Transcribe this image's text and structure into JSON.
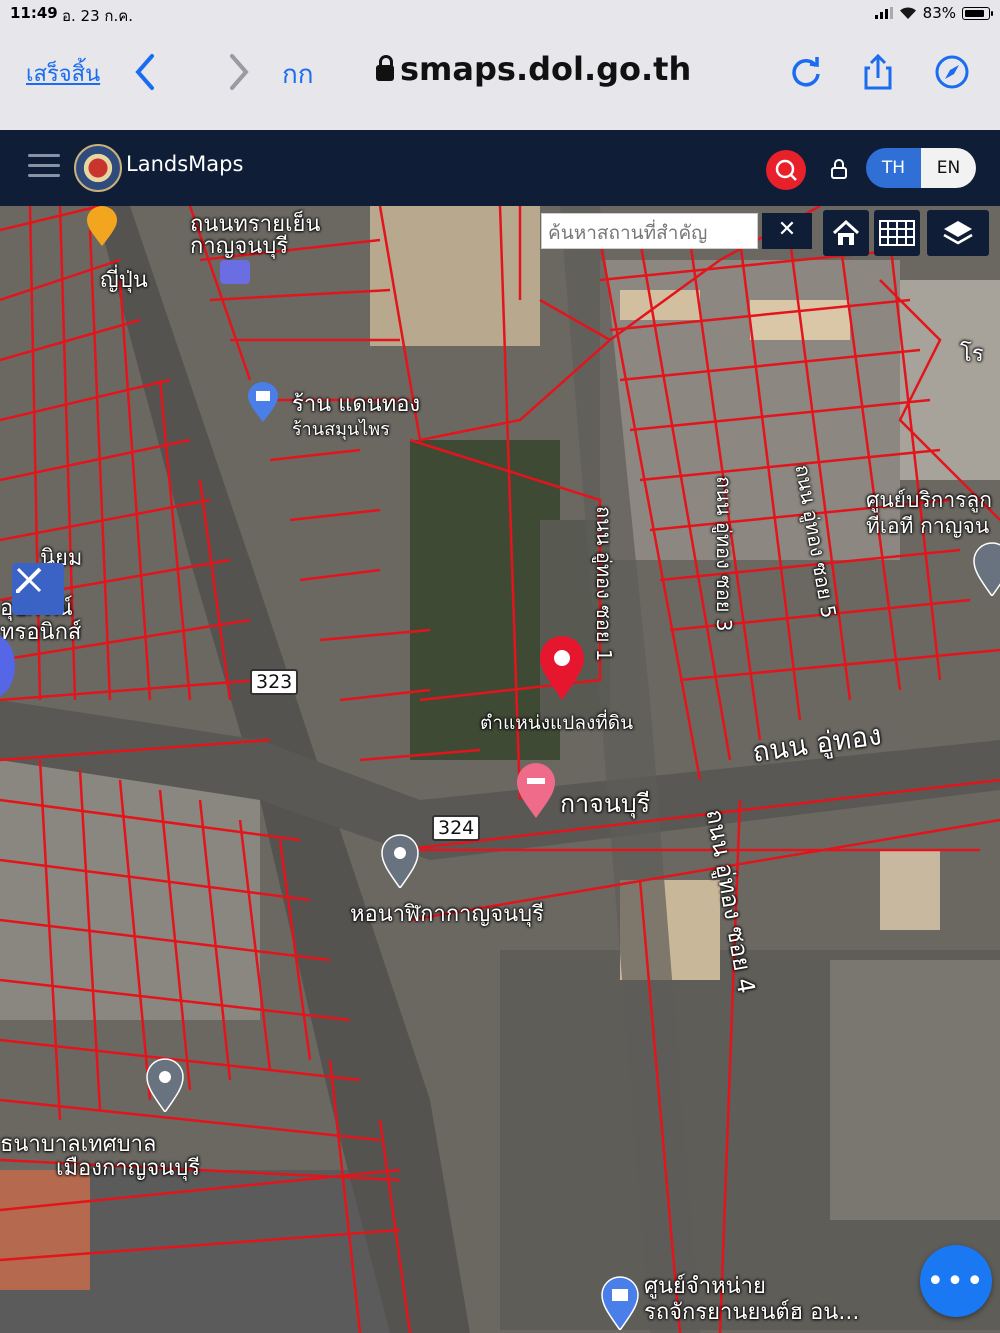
{
  "status_bar": {
    "time": "11:49",
    "date": "อ. 23 ก.ค.",
    "battery": "83%"
  },
  "browser": {
    "done_label": "เสร็จสิ้น",
    "text_size_label": "กก",
    "url": "smaps.dol.go.th",
    "icons": [
      "back-icon",
      "forward-icon",
      "lock-icon",
      "reload-icon",
      "share-icon",
      "compass-icon"
    ]
  },
  "app": {
    "brand": "LandsMaps",
    "lang_th": "TH",
    "lang_en": "EN"
  },
  "map": {
    "search_placeholder": "ค้นหาสถานที่สำคัญ",
    "clear_label": "✕",
    "marker_label": "ตำแหน่งแปลงที่ดิน",
    "labels": {
      "top_a": "ถนนทรายเย็น",
      "top_b": "กาญจนบุรี",
      "japan": "ญี่ปุ่น",
      "shop": "ร้าน แดนทอง",
      "herb": "ร้านสมุนไพร",
      "left_shop": "นิยม",
      "left_equip": "อุปกรณ์",
      "left_elec": "ทรอนิกส์",
      "utong_soi1": "ถนน อู่ทอง ซอย 1",
      "utong_soi3": "ถนน อู่ทอง ซอย 3",
      "utong_soi5": "ถนน อู่ทอง ซอย 5",
      "service_center": "ศูนย์บริการลูก",
      "service_center2": "ทีเอที กาญจน",
      "road_utong": "ถนน อู่ทอง",
      "kanchanaburi": "กาจนบุรี",
      "clock_tower": "หอนาฬิกากาญจนบุรี",
      "utong_soi4": "ถนน อู่ทอง ซอย 4",
      "bank": "ธนาบาลเทศบาล",
      "muang": "เมืองกาญจนบุรี",
      "dealer": "ศูนย์จำหน่าย",
      "dealer2": "รถจักรยานยนต์ฮ อน...",
      "right_edge": "โร"
    },
    "shields": {
      "left": "323",
      "center": "324"
    },
    "fab_label": "•••"
  }
}
